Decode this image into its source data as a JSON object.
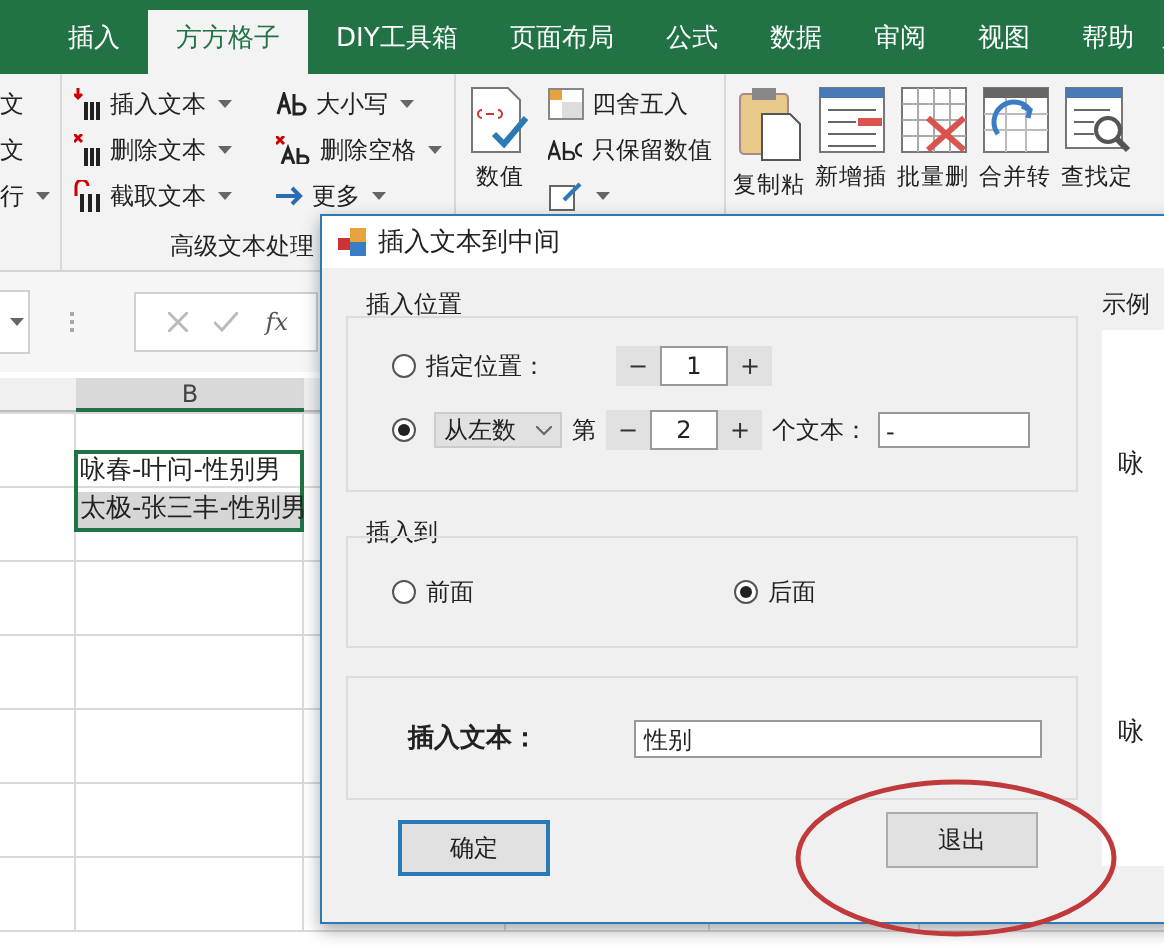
{
  "ribbon_tabs": [
    {
      "label": "插入",
      "selected": false
    },
    {
      "label": "方方格子",
      "selected": true
    },
    {
      "label": "DIY工具箱",
      "selected": false
    },
    {
      "label": "页面布局",
      "selected": false
    },
    {
      "label": "公式",
      "selected": false
    },
    {
      "label": "数据",
      "selected": false
    },
    {
      "label": "审阅",
      "selected": false
    },
    {
      "label": "视图",
      "selected": false
    },
    {
      "label": "帮助",
      "selected": false
    }
  ],
  "ribbon": {
    "cut_group": [
      {
        "label": "文",
        "dropdown": false
      },
      {
        "label": "文",
        "dropdown": false
      },
      {
        "label": "行",
        "dropdown": true
      }
    ],
    "text_group": {
      "label": "高级文本处理",
      "columns": [
        [
          {
            "label": "插入文本",
            "kind": "insert"
          },
          {
            "label": "删除文本",
            "kind": "delete"
          },
          {
            "label": "截取文本",
            "kind": "cut"
          }
        ],
        [
          {
            "label": "大小写",
            "kind": "case"
          },
          {
            "label": "删除空格",
            "kind": "space"
          },
          {
            "label": "更多",
            "kind": "more"
          }
        ]
      ]
    },
    "number_group": {
      "big": "数值",
      "items": [
        {
          "label": "四舍五入",
          "kind": "round"
        },
        {
          "label": "只保留数值",
          "kind": "abc"
        }
      ]
    },
    "big_buttons": [
      {
        "label": "复制粘",
        "kind": "paste"
      },
      {
        "label": "新增插",
        "kind": "insertrow"
      },
      {
        "label": "批量删",
        "kind": "deletegrid"
      },
      {
        "label": "合并转",
        "kind": "merge"
      },
      {
        "label": "查找定",
        "kind": "find"
      }
    ]
  },
  "formula_bar": {
    "fx": "fx"
  },
  "sheet": {
    "column_header": "B",
    "cells": [
      {
        "text": "咏春-叶问-性别男",
        "selected": false
      },
      {
        "text": "太极-张三丰-性别男",
        "selected": true
      }
    ]
  },
  "dialog": {
    "title": "插入文本到中间",
    "position_group": {
      "title": "插入位置",
      "fixed": {
        "label": "指定位置：",
        "selected": false,
        "value": "1",
        "minus": "−",
        "plus": "+"
      },
      "count": {
        "selected": true,
        "direction": "从左数",
        "prefix": "第",
        "value": "2",
        "minus": "−",
        "plus": "+",
        "suffix": "个文本：",
        "separator": "-"
      }
    },
    "insert_to_group": {
      "title": "插入到",
      "options": [
        {
          "label": "前面",
          "selected": false
        },
        {
          "label": "后面",
          "selected": true
        }
      ]
    },
    "insert_text": {
      "label": "插入文本：",
      "value": "性别"
    },
    "example": {
      "title": "示例",
      "lines": [
        "咏",
        "咏"
      ]
    },
    "buttons": [
      {
        "label": "确定",
        "focused": true
      },
      {
        "label": "退出",
        "focused": false
      }
    ]
  }
}
